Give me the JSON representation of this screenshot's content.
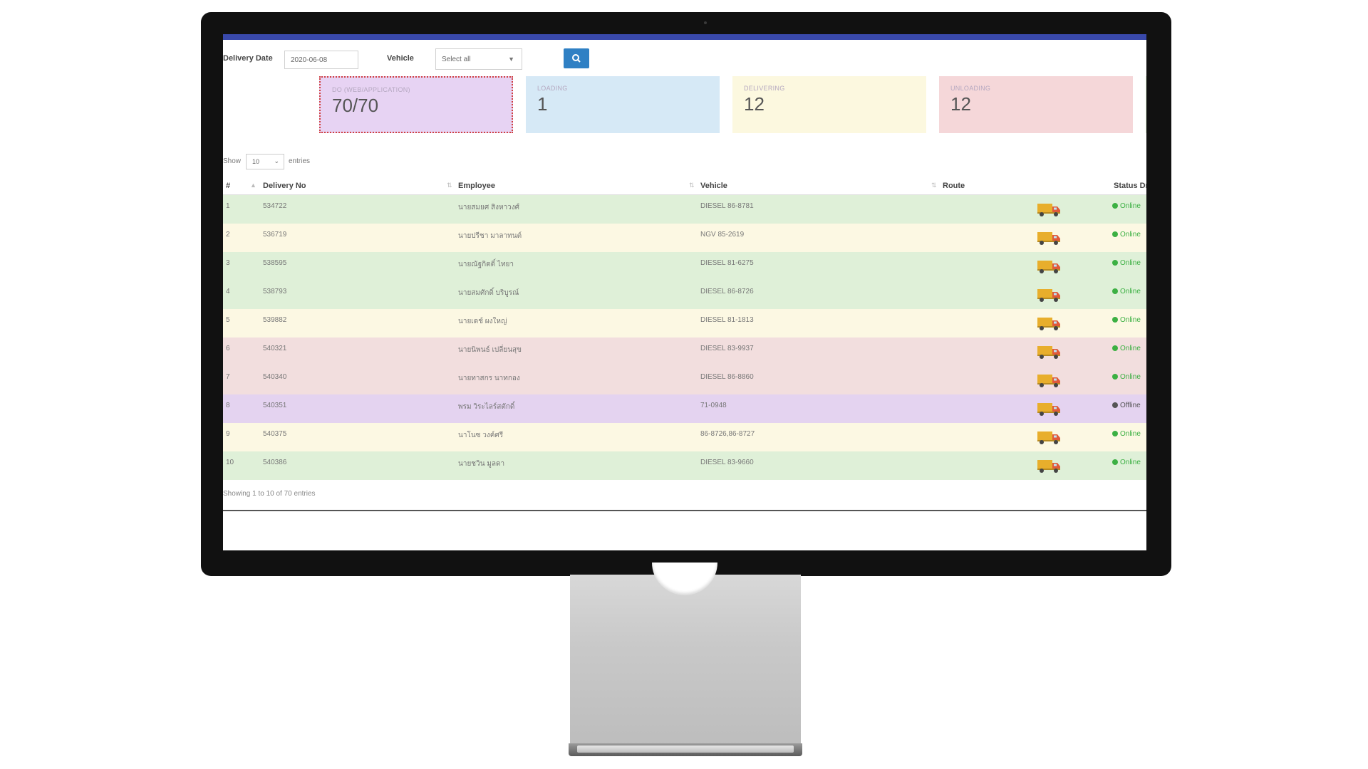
{
  "filters": {
    "delivery_date_label": "Delivery Date",
    "delivery_date_value": "2020-06-08",
    "vehicle_label": "Vehicle",
    "vehicle_selected": "Select all"
  },
  "cards": [
    {
      "label": "DO (WEB/APPLICATION)",
      "value": "70/70"
    },
    {
      "label": "LOADING",
      "value": "1"
    },
    {
      "label": "DELIVERING",
      "value": "12"
    },
    {
      "label": "UNLOADING",
      "value": "12"
    }
  ],
  "show_entries": {
    "show_label": "Show",
    "value": "10",
    "entries_label": "entries"
  },
  "table": {
    "headers": {
      "num": "#",
      "delivery_no": "Delivery No",
      "employee": "Employee",
      "vehicle": "Vehicle",
      "route": "Route",
      "status": "Status Dr"
    },
    "rows": [
      {
        "num": "1",
        "delivery_no": "534722",
        "employee": "นายสมยศ สิงหาวงศ์",
        "vehicle": "DIESEL 86-8781",
        "status": "Online",
        "bg": "#dff0d8"
      },
      {
        "num": "2",
        "delivery_no": "536719",
        "employee": "นายปรีชา มาลาทนต์",
        "vehicle": "NGV 85-2619",
        "status": "Online",
        "bg": "#fcf8e3"
      },
      {
        "num": "3",
        "delivery_no": "538595",
        "employee": "นายณัฐกิตติ์ ไทยา",
        "vehicle": "DIESEL 81-6275",
        "status": "Online",
        "bg": "#dff0d8"
      },
      {
        "num": "4",
        "delivery_no": "538793",
        "employee": "นายสมศักดิ์ บริบูรณ์",
        "vehicle": "DIESEL 86-8726",
        "status": "Online",
        "bg": "#dff0d8"
      },
      {
        "num": "5",
        "delivery_no": "539882",
        "employee": "นายเดช์ ผงใหญ่",
        "vehicle": "DIESEL 81-1813",
        "status": "Online",
        "bg": "#fcf8e3"
      },
      {
        "num": "6",
        "delivery_no": "540321",
        "employee": "นายนิพนธ์ เปลี่ยนสุข",
        "vehicle": "DIESEL 83-9937",
        "status": "Online",
        "bg": "#f2dede"
      },
      {
        "num": "7",
        "delivery_no": "540340",
        "employee": "นายทาสกร นาทกอง",
        "vehicle": "DIESEL 86-8860",
        "status": "Online",
        "bg": "#f2dede"
      },
      {
        "num": "8",
        "delivery_no": "540351",
        "employee": "พรม วิระไลร์สตักดิ์",
        "vehicle": "71-0948",
        "status": "Offline",
        "bg": "#e4d3f0"
      },
      {
        "num": "9",
        "delivery_no": "540375",
        "employee": "นาโนซ วงค์ศรี",
        "vehicle": "86-8726,86-8727",
        "status": "Online",
        "bg": "#fcf8e3"
      },
      {
        "num": "10",
        "delivery_no": "540386",
        "employee": "นายชวิน มูลดา",
        "vehicle": "DIESEL 83-9660",
        "status": "Online",
        "bg": "#dff0d8"
      }
    ]
  },
  "footer_info": "Showing 1 to 10 of 70 entries",
  "colors": {
    "online": "#3cb043",
    "offline": "#555555",
    "truck_body": "#e8ae2c",
    "truck_cab": "#e05a3a"
  }
}
